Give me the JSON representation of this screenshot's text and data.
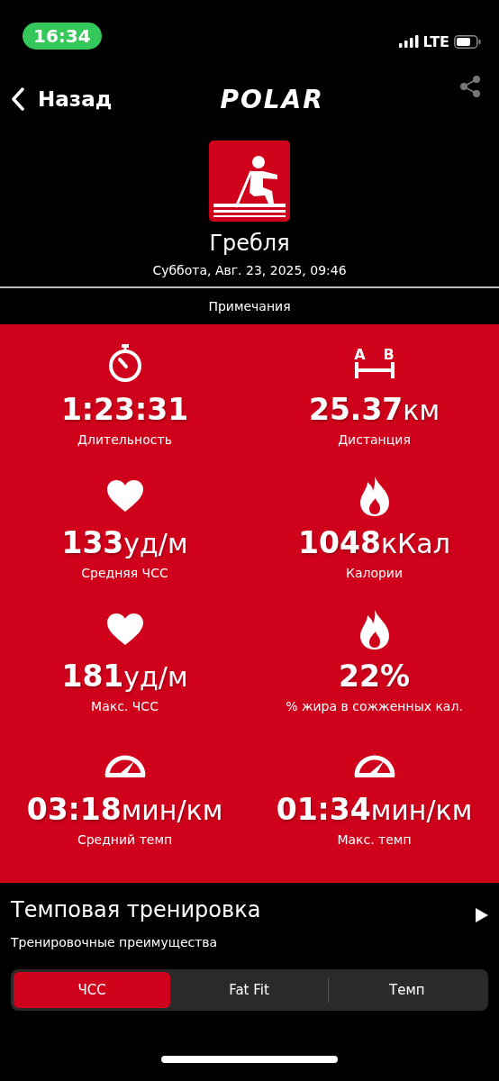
{
  "status_bar": {
    "time": "16:34",
    "network": "LTE"
  },
  "nav": {
    "back": "Назад",
    "logo": "POLAR"
  },
  "activity": {
    "title": "Гребля",
    "date": "Суббота, Авг. 23, 2025, 09:46"
  },
  "notes": "Примечания",
  "distance_icon_labels": [
    "A",
    "B"
  ],
  "stats": [
    {
      "kind": "stopwatch",
      "value": "1:23:31",
      "label": "Длительность"
    },
    {
      "kind": "distance",
      "value": "25.37",
      "unit": "км",
      "label": "Дистанция"
    },
    {
      "kind": "heart",
      "value": "133",
      "unit": "уд/м",
      "label": "Средняя ЧСС"
    },
    {
      "kind": "flame",
      "value": "1048",
      "unit": "кКал",
      "label": "Калории"
    },
    {
      "kind": "heart",
      "value": "181",
      "unit": "уд/м",
      "label": "Макс. ЧСС"
    },
    {
      "kind": "flame",
      "value": "22%",
      "label": "% жира в сожженных кал."
    },
    {
      "kind": "gauge",
      "value": "03:18",
      "unit": "мин/км",
      "label": "Средний темп"
    },
    {
      "kind": "gauge",
      "value": "01:34",
      "unit": "мин/км",
      "label": "Макс. темп"
    }
  ],
  "training": {
    "title": "Темповая тренировка",
    "subtitle": "Тренировочные преимущества"
  },
  "tabs": [
    {
      "label": "ЧСС",
      "selected": true
    },
    {
      "label": "Fat Fit",
      "selected": false
    },
    {
      "label": "Темп",
      "selected": false
    }
  ]
}
